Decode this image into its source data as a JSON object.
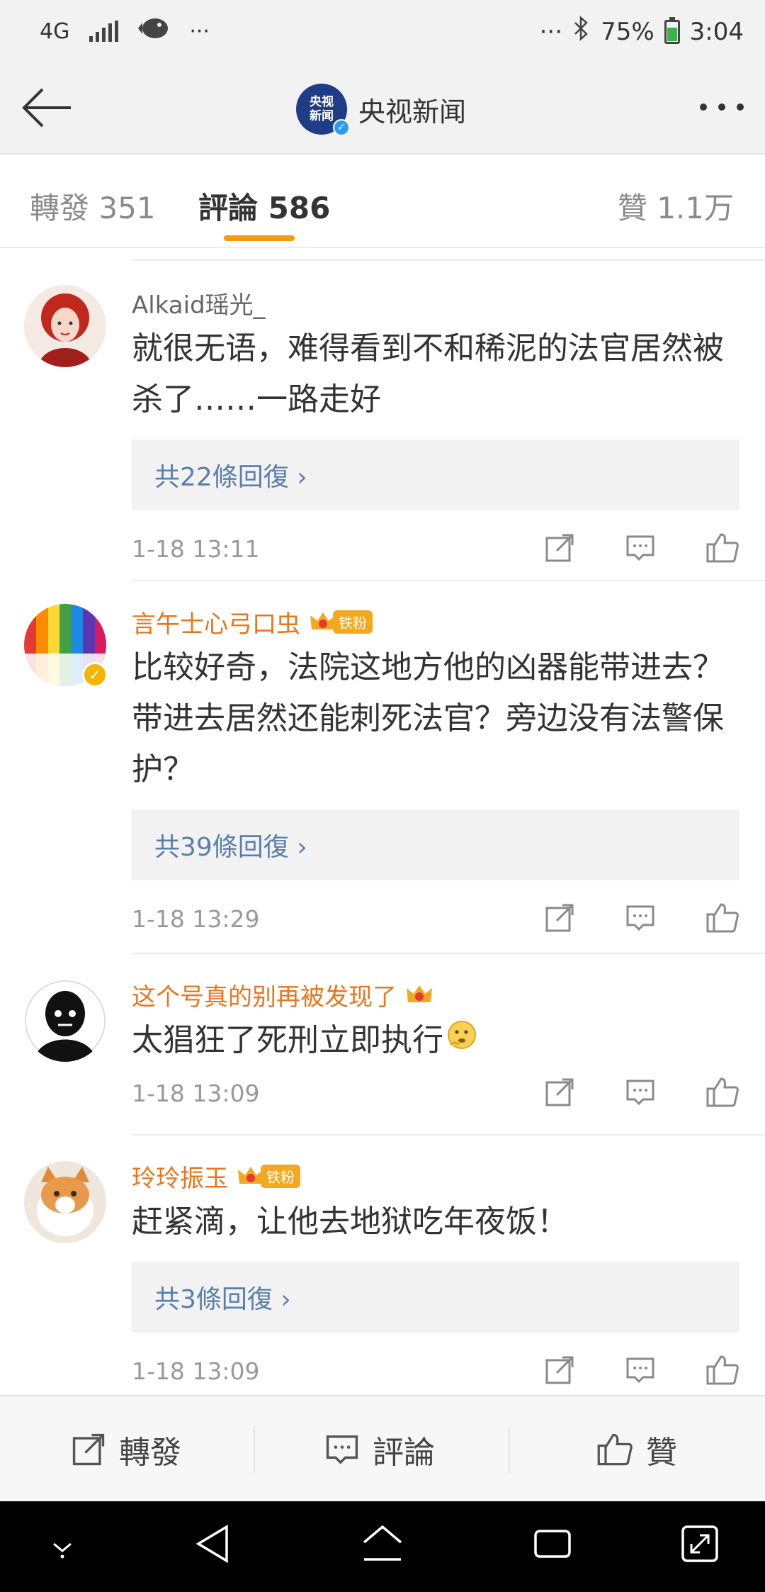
{
  "status_bar": {
    "network": "4G",
    "more": "···",
    "right_more": "···",
    "battery": "75%",
    "time": "3:04"
  },
  "header": {
    "logo_line1": "央视",
    "logo_line2": "新闻",
    "title": "央视新闻"
  },
  "tabs": {
    "repost": "轉發 351",
    "comments": "評論 586",
    "likes": "贊 1.1万"
  },
  "comments": [
    {
      "username": "Alkaid瑶光_",
      "text": "就很无语，难得看到不和稀泥的法官居然被杀了……一路走好",
      "replies": "共22條回復 ›",
      "time": "1-18 13:11"
    },
    {
      "username": "言午士心弓口虫",
      "badge": "铁粉",
      "text": "比较好奇，法院这地方他的凶器能带进去？带进去居然还能刺死法官？旁边没有法警保护？",
      "replies": "共39條回復 ›",
      "time": "1-18 13:29"
    },
    {
      "username": "这个号真的别再被发现了",
      "text": "太猖狂了死刑立即执行",
      "time": "1-18 13:09"
    },
    {
      "username": "玲玲振玉",
      "badge": "铁粉",
      "text": "赶紧滴，让他去地狱吃年夜饭！",
      "replies": "共3條回復 ›",
      "time": "1-18 13:09"
    }
  ],
  "bottom_bar": {
    "repost": "轉發",
    "comment": "評論",
    "like": "贊"
  },
  "colors": {
    "accent": "#f39c12",
    "vip_name": "#e8761c",
    "reply_link": "#5a7faa"
  }
}
